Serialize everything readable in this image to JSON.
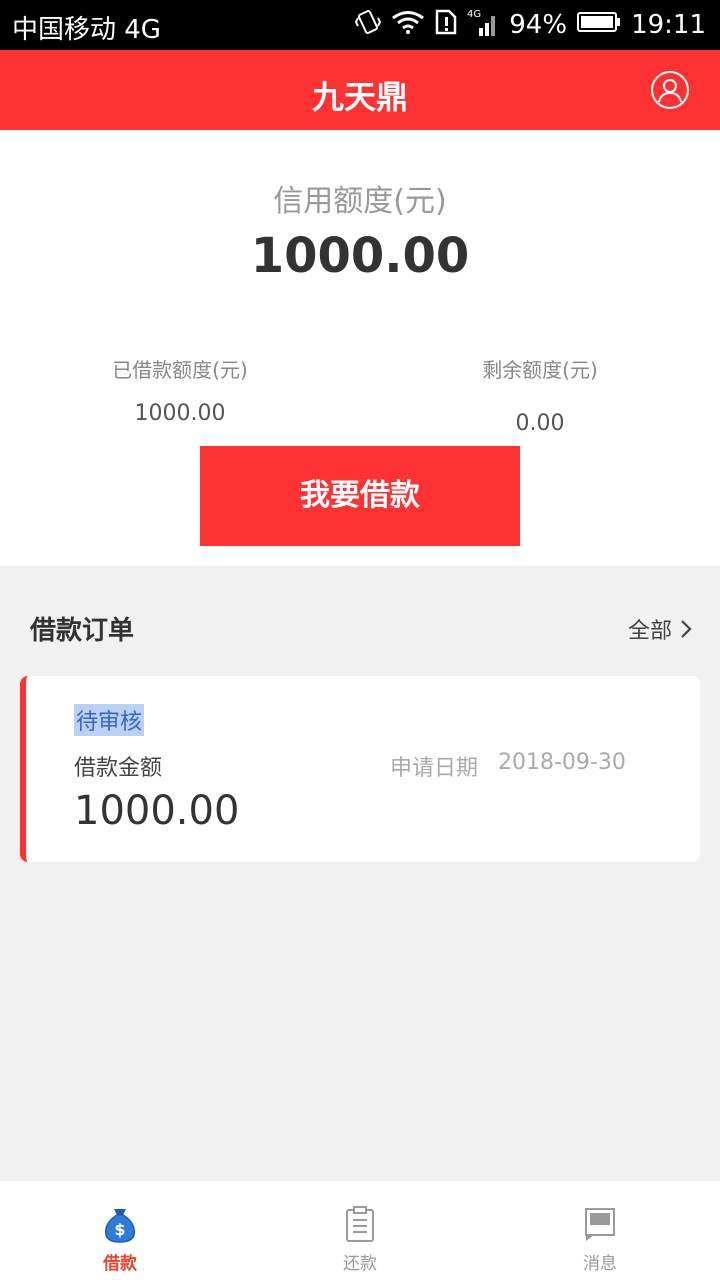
{
  "statusbar": {
    "carrier": "中国移动 4G",
    "network": "4G",
    "battery": "94%",
    "time": "19:11"
  },
  "header": {
    "title": "九天鼎"
  },
  "credit": {
    "label": "信用额度(元)",
    "value": "1000.00",
    "borrowed_label": "已借款额度(元)",
    "borrowed_value": "1000.00",
    "remaining_label": "剩余额度(元)",
    "remaining_value": "0.00",
    "borrow_button": "我要借款"
  },
  "orders": {
    "title": "借款订单",
    "all_label": "全部",
    "items": [
      {
        "status": "待审核",
        "amount_label": "借款金额",
        "amount": "1000.00",
        "date_label": "申请日期",
        "date": "2018-09-30"
      }
    ]
  },
  "tabs": [
    {
      "label": "借款",
      "icon": "money-bag-icon",
      "active": true
    },
    {
      "label": "还款",
      "icon": "clipboard-icon",
      "active": false
    },
    {
      "label": "消息",
      "icon": "message-icon",
      "active": false
    }
  ],
  "colors": {
    "brand": "#fe3233",
    "active_tab": "#e8442e",
    "inactive_tab": "#999999"
  }
}
